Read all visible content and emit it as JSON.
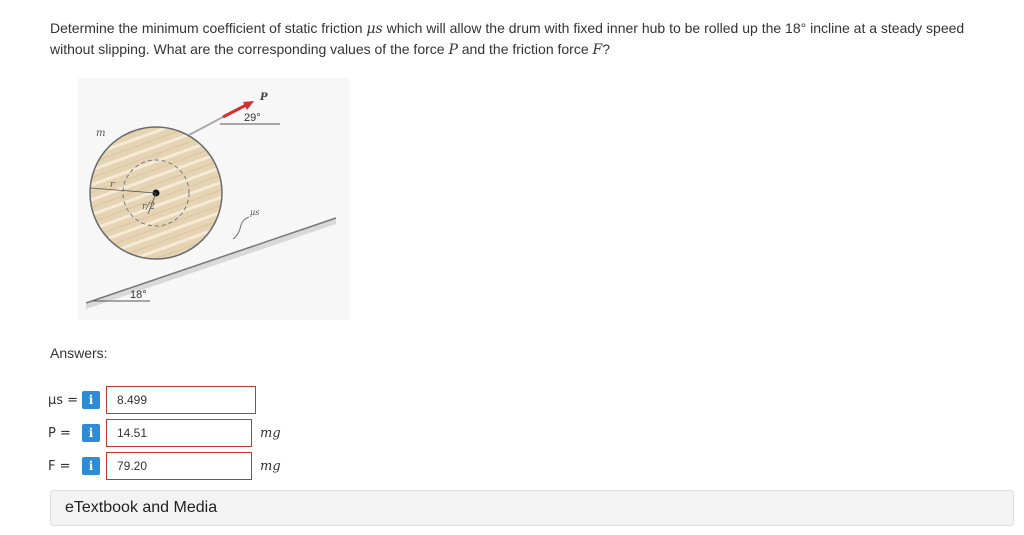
{
  "question": {
    "part1": "Determine the minimum coefficient of static friction ",
    "mu_symbol": "μs",
    "part2": " which will allow the drum with fixed inner hub to be rolled up the 18° incline at a steady speed without slipping. What are the corresponding values of the force ",
    "P": "P",
    "part3": " and the friction force ",
    "F": "F",
    "part4": "?"
  },
  "figure": {
    "label_m": "m",
    "label_P": "P",
    "label_angle_top": "29°",
    "label_angle_bottom": "18°",
    "label_r": "r",
    "label_r2": "r/2",
    "label_mu": "μs"
  },
  "answers": {
    "heading": "Answers:",
    "rows": [
      {
        "label": "μs =",
        "value": "8.499",
        "unit": ""
      },
      {
        "label": "P =",
        "value": "14.51",
        "unit": "mg"
      },
      {
        "label": "F =",
        "value": "79.20",
        "unit": "mg"
      }
    ],
    "info_icon_glyph": "i"
  },
  "etextbook": {
    "label": "eTextbook and Media"
  },
  "colors": {
    "info_icon": "#2e8bd6",
    "input_border": "#c0392b",
    "arrow": "#d32f2f"
  }
}
